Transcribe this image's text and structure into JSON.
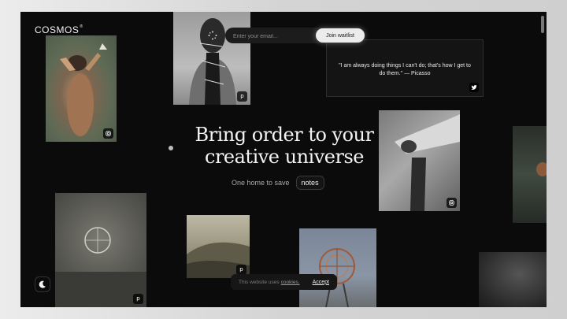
{
  "brand": {
    "name": "COSMOS",
    "mark": "®"
  },
  "waitlist": {
    "placeholder": "Enter your email...",
    "button_label": "Join waitlist"
  },
  "quote": {
    "text": "\"I am always doing things I can't do; that's how I get to do them.\" — Picasso"
  },
  "hero": {
    "headline_line1": "Bring order to your",
    "headline_line2": "creative universe",
    "subtitle": "One home to save",
    "pill": "notes"
  },
  "cookie": {
    "text": "This website uses",
    "link": "cookies.",
    "accept_label": "Accept"
  },
  "badges": {
    "pinterest": "p"
  },
  "colors": {
    "background": "#0b0b0b",
    "text": "#f3f3f3",
    "page_frame": "#d9d9d9"
  },
  "icons": [
    "sparkle-icon",
    "instagram-icon",
    "pinterest-icon",
    "twitter-icon",
    "moon-icon"
  ]
}
